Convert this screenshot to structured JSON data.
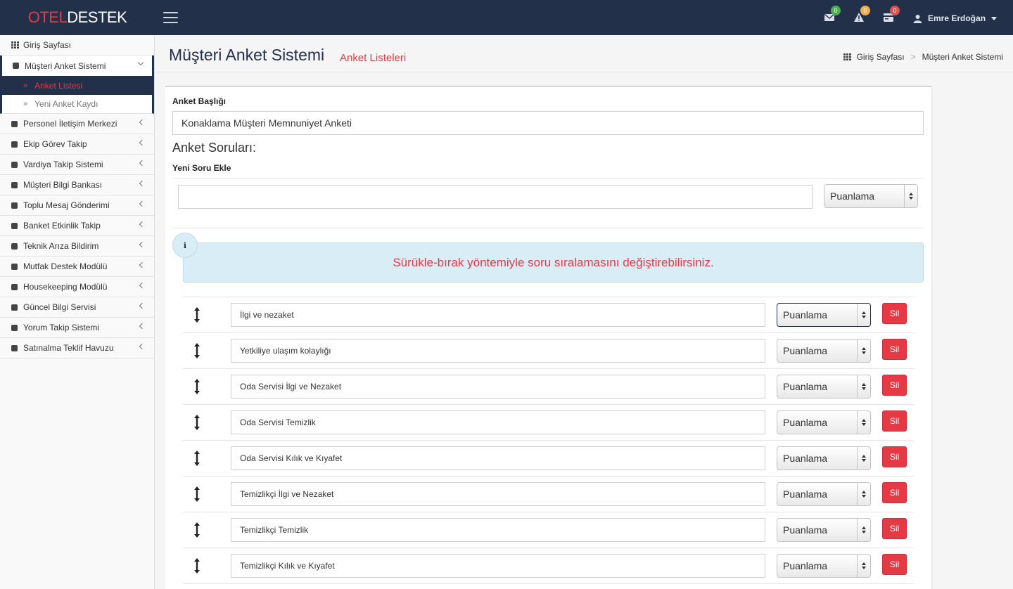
{
  "header": {
    "logo_part1": "OTEL",
    "logo_part2": "DESTEK",
    "messages_count": "0",
    "alerts_count": "0",
    "tasks_count": "0",
    "user_name": "Emre Erdoğan",
    "colors": {
      "bar": "#22304a",
      "green_badge": "#4cae4c",
      "orange_badge": "#f0ad4e",
      "red_badge": "#d9534f"
    }
  },
  "sidebar": {
    "home": "Giriş Sayfası",
    "open_module": "Müşteri Anket Sistemi",
    "sub_items": [
      "Anket Listesi",
      "Yeni Anket Kaydı"
    ],
    "modules": [
      "Personel İletişim Merkezi",
      "Ekip Görev Takip",
      "Vardiya Takip Sistemi",
      "Müşteri Bilgi Bankası",
      "Toplu Mesaj Gönderimi",
      "Banket Etkinlik Takip",
      "Teknik Arıza Bildirim",
      "Mutfak Destek Modülü",
      "Housekeeping Modülü",
      "Güncel Bilgi Servisi",
      "Yorum Takip Sistemi",
      "Satınalma Teklif Havuzu"
    ]
  },
  "page": {
    "title": "Müşteri Anket Sistemi",
    "subtitle": "Anket Listeleri",
    "breadcrumb": [
      "Giriş Sayfası",
      "Müşteri Anket Sistemi"
    ]
  },
  "form": {
    "title_label": "Anket Başlığı",
    "title_value": "Konaklama Müşteri Memnuniyet Anketi",
    "questions_heading": "Anket Soruları:",
    "new_question_label": "Yeni Soru Ekle",
    "new_question_value": "",
    "new_question_type": "Puanlama",
    "info_text": "Sürükle-bırak yöntemiyle soru sıralamasını değiştirebilirsiniz.",
    "delete_label": "Sil",
    "questions": [
      {
        "text": "İlgi ve nezaket",
        "type": "Puanlama"
      },
      {
        "text": "Yetkiliye ulaşım kolaylığı",
        "type": "Puanlama"
      },
      {
        "text": "Oda Servisi İlgi ve Nezaket",
        "type": "Puanlama"
      },
      {
        "text": "Oda Servisi Temizlik",
        "type": "Puanlama"
      },
      {
        "text": "Oda Servisi Kılık ve Kıyafet",
        "type": "Puanlama"
      },
      {
        "text": "Temizlikçi İlgi ve Nezaket",
        "type": "Puanlama"
      },
      {
        "text": "Temizlikçi Temizlik",
        "type": "Puanlama"
      },
      {
        "text": "Temizlikçi Kılık ve Kıyafet",
        "type": "Puanlama"
      }
    ]
  }
}
